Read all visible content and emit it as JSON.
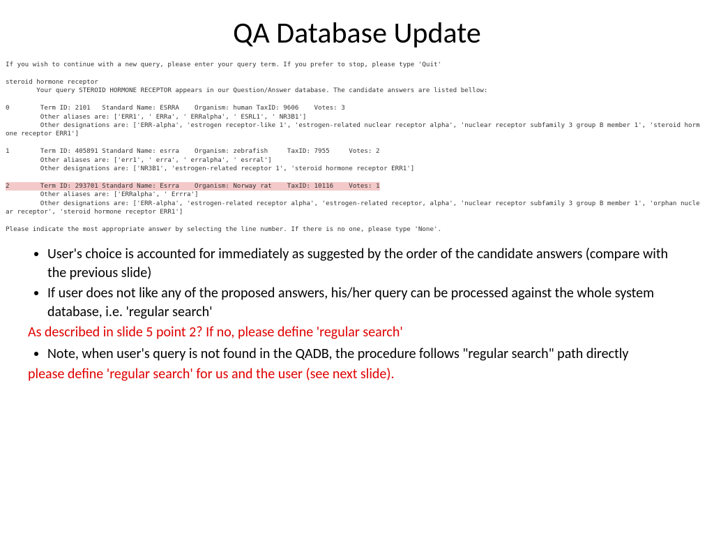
{
  "title": "QA Database Update",
  "terminal": {
    "prompt1": "If you wish to continue with a new query, please enter your query term. If you prefer to stop, please type 'Quit'",
    "query": "steroid hormone receptor",
    "match_msg": "        Your query STEROID HORMONE RECEPTOR appears in our Question/Answer database. The candidate answers are listed bellow:",
    "r0_header": "0        Term ID: 2101   Standard Name: ESRRA    Organism: human TaxID: 9606    Votes: 3",
    "r0_aliases": "         Other aliases are: ['ERR1', ' ERRa', ' ERRalpha', ' ESRL1', ' NR3B1']",
    "r0_desig": "         Other designations are: ['ERR-alpha', 'estrogen receptor-like 1', 'estrogen-related nuclear receptor alpha', 'nuclear receptor subfamily 3 group B member 1', 'steroid horm",
    "r0_cont": "one receptor ERR1']",
    "r1_header": "1        Term ID: 405891 Standard Name: esrra    Organism: zebrafish     TaxID: 7955     Votes: 2",
    "r1_aliases": "         Other aliases are: ['err1', ' erra', ' erralpha', ' esrral']",
    "r1_desig": "         Other designations are: ['NR3B1', 'estrogen-related receptor 1', 'steroid hormone receptor ERR1']",
    "r2_header": "2        Term ID: 293701 Standard Name: Esrra    Organism: Norway rat    TaxID: 10116    Votes: 1",
    "r2_aliases": "         Other aliases are: ['ERRalpha', ' Errra']",
    "r2_desig": "         Other designations are: ['ERR-alpha', 'estrogen-related receptor alpha', 'estrogen-related receptor, alpha', 'nuclear receptor subfamily 3 group B member 1', 'orphan nucle",
    "r2_cont": "ar receptor', 'steroid hormone receptor ERR1']",
    "prompt2": "Please indicate the most appropriate answer by selecting the line number. If there is no one, please type 'None'."
  },
  "bullets": {
    "b1": "User's choice is accounted for immediately as suggested by the order of the candidate answers (compare with the previous slide)",
    "b2": "If user does not like any of the proposed answers, his/her query can be processed against the whole system database, i.e. 'regular search'",
    "red1": "As described in slide 5 point 2? If no, please define 'regular search'",
    "b3": "Note, when user's query is not found in the QADB, the procedure follows \"regular search\" path directly",
    "red2": "please define 'regular search' for us and the user (see next slide)."
  }
}
